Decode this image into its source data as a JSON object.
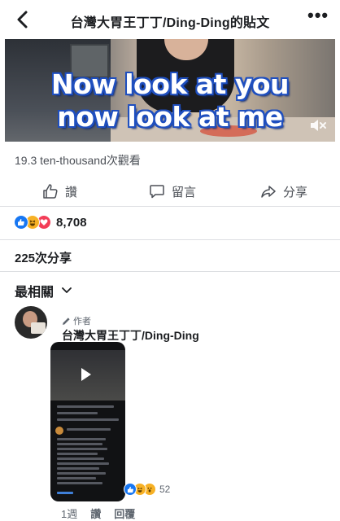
{
  "header": {
    "title": "台灣大胃王丁丁/Ding-Ding的貼文",
    "back_icon": "chevron-left-icon",
    "more_icon": "more-horizontal-icon",
    "more_label": "•••"
  },
  "video": {
    "caption_line1": "Now look at you",
    "caption_line2": "now look at me",
    "mute_icon": "speaker-muted-icon"
  },
  "post": {
    "views": "19.3 ten-thousand次觀看",
    "actions": {
      "like": "讚",
      "comment": "留言",
      "share": "分享"
    },
    "reactions": {
      "types": [
        "like",
        "haha",
        "love"
      ],
      "count": "8,708"
    },
    "shares": "225次分享"
  },
  "comments": {
    "sort_label": "最相關",
    "first": {
      "author_badge": "作者",
      "author_name": "台灣大胃王丁丁/Ding-Ding",
      "reactions": {
        "types": [
          "like",
          "haha",
          "wow"
        ],
        "count": "52"
      },
      "time": "1週",
      "like_label": "讚",
      "reply_label": "回覆"
    }
  },
  "colors": {
    "facebook_blue": "#1877f2",
    "haha_yellow": "#f7b125",
    "love_red": "#f33e58",
    "caption_outline": "#1f4fbf"
  }
}
